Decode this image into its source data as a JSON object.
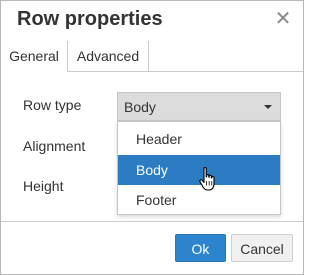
{
  "dialog": {
    "title": "Row properties",
    "close_glyph": "✕"
  },
  "tabs": [
    {
      "label": "General",
      "active": true
    },
    {
      "label": "Advanced",
      "active": false
    }
  ],
  "form": {
    "row_type_label": "Row type",
    "alignment_label": "Alignment",
    "height_label": "Height",
    "row_type_value": "Body"
  },
  "dropdown": {
    "options": [
      "Header",
      "Body",
      "Footer"
    ],
    "selected": "Body"
  },
  "buttons": {
    "ok": "Ok",
    "cancel": "Cancel"
  },
  "colors": {
    "accent": "#2b84cc",
    "selected_option": "#2c7cc3"
  },
  "icons": {
    "close": "close-icon",
    "caret": "chevron-down-icon",
    "cursor": "hand-pointer-icon"
  }
}
